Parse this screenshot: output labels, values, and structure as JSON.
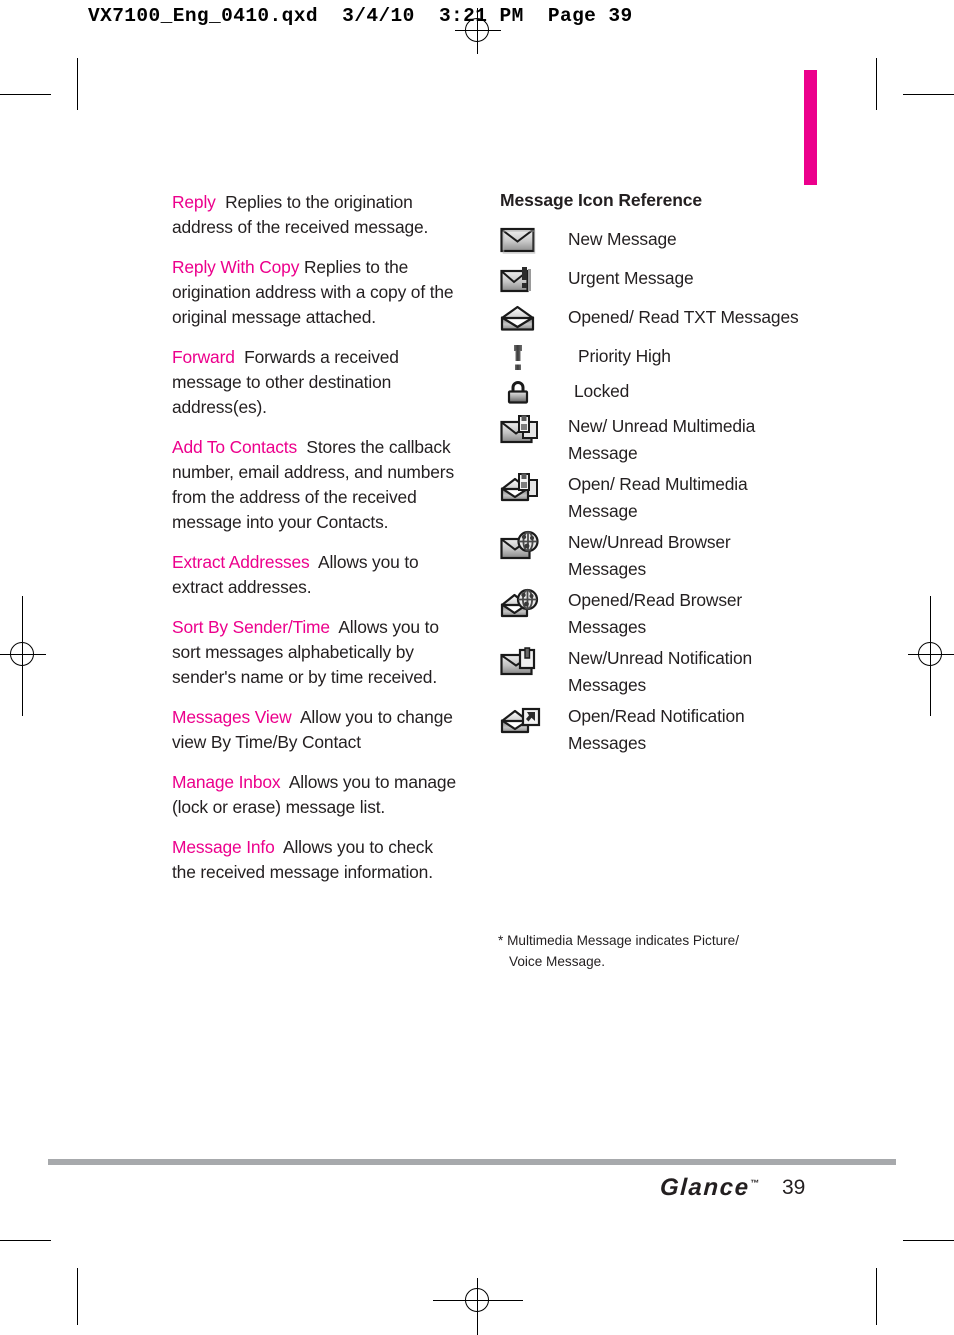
{
  "slug": "VX7100_Eng_0410.qxd  3/4/10  3:21 PM  Page 39",
  "colors": {
    "accent_pink": "#EC008C",
    "body_text": "#231F20",
    "footer_rule": "#A7A9AC"
  },
  "left_column": {
    "entries": [
      {
        "term": "Reply",
        "description": "Replies to the origination address of the received message."
      },
      {
        "term": "Reply With Copy",
        "description": "Replies to the origination address with a copy of the original message attached."
      },
      {
        "term": "Forward",
        "description": "Forwards a received message to other destination address(es)."
      },
      {
        "term": "Add To Contacts",
        "description": "Stores the callback number, email address, and numbers from the address of the received message into your Contacts."
      },
      {
        "term": "Extract Addresses",
        "description": "Allows you to extract addresses."
      },
      {
        "term": "Sort By Sender/Time",
        "description": "Allows you to sort messages alphabetically by sender's name or by time received."
      },
      {
        "term": "Messages View",
        "description": "Allow you to change view By Time/By Contact"
      },
      {
        "term": "Manage Inbox",
        "description": "Allows you to manage (lock or erase) message list."
      },
      {
        "term": "Message Info",
        "description": "Allows you to check the received message information."
      }
    ]
  },
  "right_column": {
    "heading": "Message Icon Reference",
    "icons": [
      {
        "icon": "envelope-closed-icon",
        "label": "New Message"
      },
      {
        "icon": "envelope-exclamation-icon",
        "label": "Urgent Message"
      },
      {
        "icon": "envelope-open-icon",
        "label": "Opened/ Read TXT Messages"
      },
      {
        "icon": "exclamation-mark-icon",
        "label": "Priority High"
      },
      {
        "icon": "padlock-icon",
        "label": "Locked"
      },
      {
        "icon": "envelope-closed-multimedia-icon",
        "label": "New/ Unread Multimedia Message"
      },
      {
        "icon": "envelope-open-multimedia-icon",
        "label": "Open/ Read Multimedia Message"
      },
      {
        "icon": "envelope-closed-globe-icon",
        "label": "New/Unread Browser Messages"
      },
      {
        "icon": "envelope-open-globe-icon",
        "label": "Opened/Read Browser Messages"
      },
      {
        "icon": "envelope-closed-notification-icon",
        "label": "New/Unread Notification Messages"
      },
      {
        "icon": "envelope-open-notification-icon",
        "label": "Open/Read Notification Messages"
      }
    ],
    "footnote_line1": "* Multimedia Message indicates Picture/",
    "footnote_line2": "Voice Message."
  },
  "footer": {
    "brand": "Glance",
    "trademark": "™",
    "page_number": "39"
  }
}
